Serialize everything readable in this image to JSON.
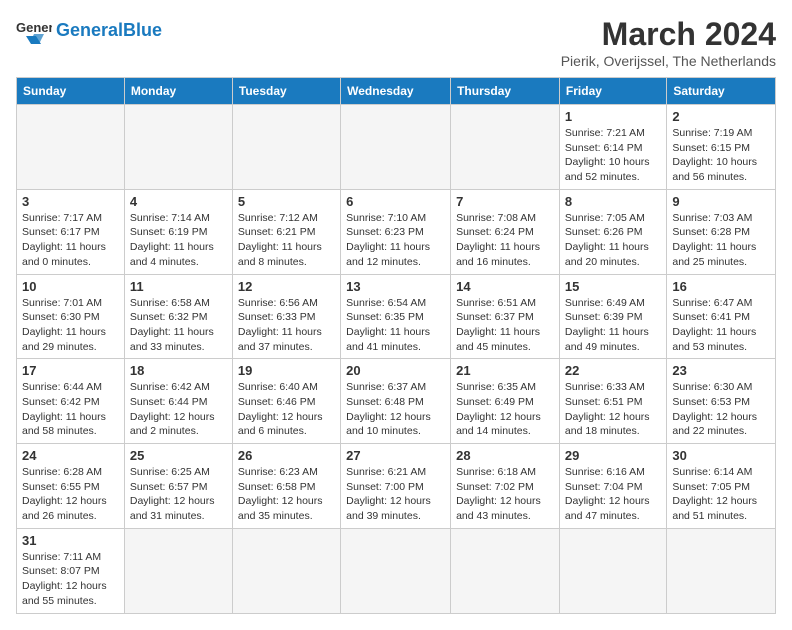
{
  "header": {
    "logo_general": "General",
    "logo_blue": "Blue",
    "month_title": "March 2024",
    "subtitle": "Pierik, Overijssel, The Netherlands"
  },
  "weekdays": [
    "Sunday",
    "Monday",
    "Tuesday",
    "Wednesday",
    "Thursday",
    "Friday",
    "Saturday"
  ],
  "weeks": [
    [
      {
        "day": "",
        "info": ""
      },
      {
        "day": "",
        "info": ""
      },
      {
        "day": "",
        "info": ""
      },
      {
        "day": "",
        "info": ""
      },
      {
        "day": "",
        "info": ""
      },
      {
        "day": "1",
        "info": "Sunrise: 7:21 AM\nSunset: 6:14 PM\nDaylight: 10 hours and 52 minutes."
      },
      {
        "day": "2",
        "info": "Sunrise: 7:19 AM\nSunset: 6:15 PM\nDaylight: 10 hours and 56 minutes."
      }
    ],
    [
      {
        "day": "3",
        "info": "Sunrise: 7:17 AM\nSunset: 6:17 PM\nDaylight: 11 hours and 0 minutes."
      },
      {
        "day": "4",
        "info": "Sunrise: 7:14 AM\nSunset: 6:19 PM\nDaylight: 11 hours and 4 minutes."
      },
      {
        "day": "5",
        "info": "Sunrise: 7:12 AM\nSunset: 6:21 PM\nDaylight: 11 hours and 8 minutes."
      },
      {
        "day": "6",
        "info": "Sunrise: 7:10 AM\nSunset: 6:23 PM\nDaylight: 11 hours and 12 minutes."
      },
      {
        "day": "7",
        "info": "Sunrise: 7:08 AM\nSunset: 6:24 PM\nDaylight: 11 hours and 16 minutes."
      },
      {
        "day": "8",
        "info": "Sunrise: 7:05 AM\nSunset: 6:26 PM\nDaylight: 11 hours and 20 minutes."
      },
      {
        "day": "9",
        "info": "Sunrise: 7:03 AM\nSunset: 6:28 PM\nDaylight: 11 hours and 25 minutes."
      }
    ],
    [
      {
        "day": "10",
        "info": "Sunrise: 7:01 AM\nSunset: 6:30 PM\nDaylight: 11 hours and 29 minutes."
      },
      {
        "day": "11",
        "info": "Sunrise: 6:58 AM\nSunset: 6:32 PM\nDaylight: 11 hours and 33 minutes."
      },
      {
        "day": "12",
        "info": "Sunrise: 6:56 AM\nSunset: 6:33 PM\nDaylight: 11 hours and 37 minutes."
      },
      {
        "day": "13",
        "info": "Sunrise: 6:54 AM\nSunset: 6:35 PM\nDaylight: 11 hours and 41 minutes."
      },
      {
        "day": "14",
        "info": "Sunrise: 6:51 AM\nSunset: 6:37 PM\nDaylight: 11 hours and 45 minutes."
      },
      {
        "day": "15",
        "info": "Sunrise: 6:49 AM\nSunset: 6:39 PM\nDaylight: 11 hours and 49 minutes."
      },
      {
        "day": "16",
        "info": "Sunrise: 6:47 AM\nSunset: 6:41 PM\nDaylight: 11 hours and 53 minutes."
      }
    ],
    [
      {
        "day": "17",
        "info": "Sunrise: 6:44 AM\nSunset: 6:42 PM\nDaylight: 11 hours and 58 minutes."
      },
      {
        "day": "18",
        "info": "Sunrise: 6:42 AM\nSunset: 6:44 PM\nDaylight: 12 hours and 2 minutes."
      },
      {
        "day": "19",
        "info": "Sunrise: 6:40 AM\nSunset: 6:46 PM\nDaylight: 12 hours and 6 minutes."
      },
      {
        "day": "20",
        "info": "Sunrise: 6:37 AM\nSunset: 6:48 PM\nDaylight: 12 hours and 10 minutes."
      },
      {
        "day": "21",
        "info": "Sunrise: 6:35 AM\nSunset: 6:49 PM\nDaylight: 12 hours and 14 minutes."
      },
      {
        "day": "22",
        "info": "Sunrise: 6:33 AM\nSunset: 6:51 PM\nDaylight: 12 hours and 18 minutes."
      },
      {
        "day": "23",
        "info": "Sunrise: 6:30 AM\nSunset: 6:53 PM\nDaylight: 12 hours and 22 minutes."
      }
    ],
    [
      {
        "day": "24",
        "info": "Sunrise: 6:28 AM\nSunset: 6:55 PM\nDaylight: 12 hours and 26 minutes."
      },
      {
        "day": "25",
        "info": "Sunrise: 6:25 AM\nSunset: 6:57 PM\nDaylight: 12 hours and 31 minutes."
      },
      {
        "day": "26",
        "info": "Sunrise: 6:23 AM\nSunset: 6:58 PM\nDaylight: 12 hours and 35 minutes."
      },
      {
        "day": "27",
        "info": "Sunrise: 6:21 AM\nSunset: 7:00 PM\nDaylight: 12 hours and 39 minutes."
      },
      {
        "day": "28",
        "info": "Sunrise: 6:18 AM\nSunset: 7:02 PM\nDaylight: 12 hours and 43 minutes."
      },
      {
        "day": "29",
        "info": "Sunrise: 6:16 AM\nSunset: 7:04 PM\nDaylight: 12 hours and 47 minutes."
      },
      {
        "day": "30",
        "info": "Sunrise: 6:14 AM\nSunset: 7:05 PM\nDaylight: 12 hours and 51 minutes."
      }
    ],
    [
      {
        "day": "31",
        "info": "Sunrise: 7:11 AM\nSunset: 8:07 PM\nDaylight: 12 hours and 55 minutes."
      },
      {
        "day": "",
        "info": ""
      },
      {
        "day": "",
        "info": ""
      },
      {
        "day": "",
        "info": ""
      },
      {
        "day": "",
        "info": ""
      },
      {
        "day": "",
        "info": ""
      },
      {
        "day": "",
        "info": ""
      }
    ]
  ]
}
